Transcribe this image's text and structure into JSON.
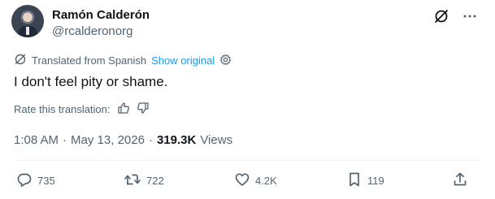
{
  "author": {
    "display_name": "Ramón Calderón",
    "handle": "@rcalderonorg"
  },
  "translation": {
    "label": "Translated from Spanish",
    "show_original": "Show original"
  },
  "tweet": {
    "text": "I don't feel pity or shame."
  },
  "rating": {
    "label": "Rate this translation:"
  },
  "meta": {
    "time": "1:08 AM",
    "separator1": "·",
    "date": "May 13, 2026",
    "separator2": "·",
    "views_count": "319.3K",
    "views_label": "Views"
  },
  "actions": {
    "replies": "735",
    "reposts": "722",
    "likes": "4.2K",
    "bookmarks": "119"
  },
  "colors": {
    "accent": "#1d9bf0",
    "secondary_text": "#536471",
    "primary_text": "#0f1419"
  },
  "icons": [
    "grok-icon",
    "more-icon",
    "translate-icon",
    "settings-icon",
    "thumbs-up-icon",
    "thumbs-down-icon",
    "reply-icon",
    "repost-icon",
    "like-icon",
    "bookmark-icon",
    "share-icon"
  ]
}
